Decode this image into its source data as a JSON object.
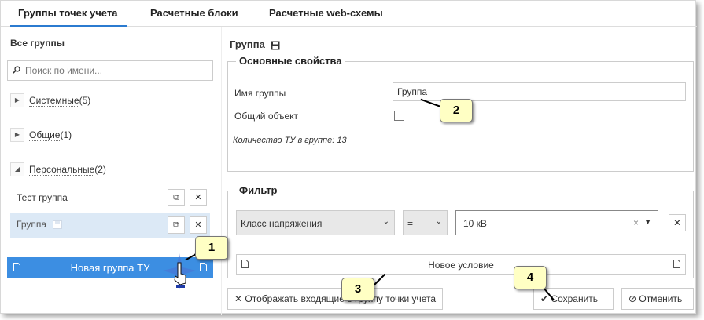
{
  "tabs": [
    {
      "label": "Группы точек учета",
      "active": true
    },
    {
      "label": "Расчетные блоки",
      "active": false
    },
    {
      "label": "Расчетные web-схемы",
      "active": false
    }
  ],
  "left": {
    "all_groups": "Все группы",
    "search_placeholder": "Поиск по имени...",
    "categories": [
      {
        "name": "Системные",
        "count": "(5)",
        "expanded": false
      },
      {
        "name": "Общие",
        "count": "(1)",
        "expanded": false
      },
      {
        "name": "Персональные",
        "count": "(2)",
        "expanded": true
      }
    ],
    "groups": [
      {
        "name": "Тест группа",
        "selected": false
      },
      {
        "name": "Группа",
        "selected": true
      }
    ],
    "new_group": "Новая группа ТУ"
  },
  "right": {
    "title": "Группа",
    "basic_legend": "Основные свойства",
    "name_label": "Имя группы",
    "name_value": "Группа",
    "shared_label": "Общий объект",
    "count_text": "Количество ТУ в группе:  13",
    "filter_legend": "Фильтр",
    "filter": {
      "field": "Класс напряжения",
      "operator": "=",
      "value": "10 кВ"
    },
    "new_condition": "Новое условие",
    "show_incoming": "Отображать входящие в группу точки учета",
    "save": "Сохранить",
    "cancel": "Отменить"
  },
  "callouts": [
    "1",
    "2",
    "3",
    "4"
  ],
  "colors": {
    "accent": "#3c8ee2",
    "selected_row": "#dce9f6",
    "callout_bg": "#ffffc4"
  }
}
